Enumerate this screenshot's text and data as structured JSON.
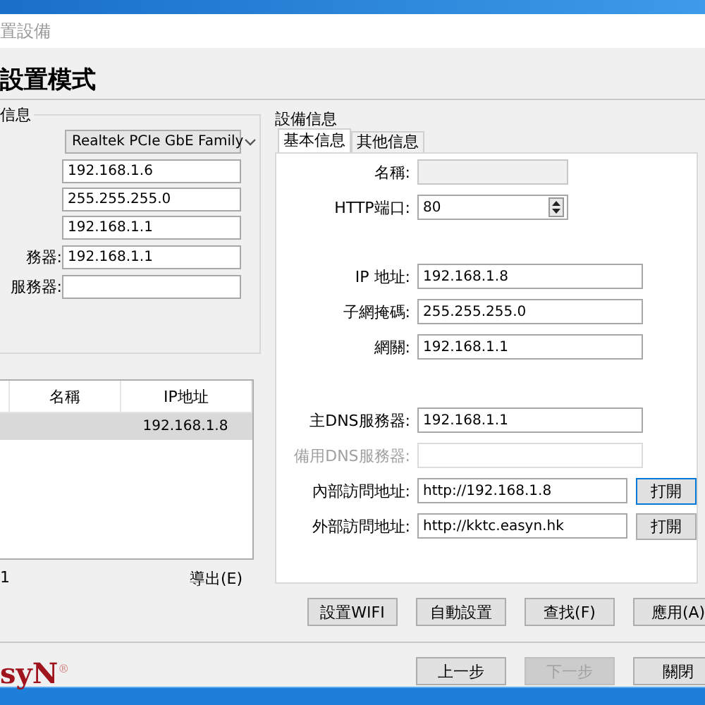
{
  "window": {
    "title": "置設備"
  },
  "heading": "設置模式",
  "network_group": {
    "title": "信息",
    "adapter": "Realtek PCIe GbE Family",
    "fields": [
      {
        "value": "192.168.1.6"
      },
      {
        "value": "255.255.255.0"
      },
      {
        "value": "192.168.1.1"
      },
      {
        "label": "務器:",
        "value": "192.168.1.1"
      },
      {
        "label": "服務器:"
      }
    ]
  },
  "device_table": {
    "columns": [
      "名稱",
      "IP地址"
    ],
    "rows": [
      {
        "ip": "192.168.1.8",
        "selected": true
      }
    ]
  },
  "device_count": "1",
  "export_link": "導出(E)",
  "device_info": {
    "title": "設備信息",
    "tabs": [
      {
        "label": "基本信息",
        "selected": true
      },
      {
        "label": "其他信息",
        "selected": false
      }
    ],
    "sections": [
      [
        {
          "kind": "text",
          "label": "名稱:",
          "read_only": true
        },
        {
          "kind": "spinner",
          "label": "HTTP端口:",
          "value": "80"
        }
      ],
      [
        {
          "kind": "text",
          "label": "IP 地址:",
          "value": "192.168.1.8"
        },
        {
          "kind": "text",
          "label": "子網掩碼:",
          "value": "255.255.255.0"
        },
        {
          "kind": "text",
          "label": "網關:",
          "value": "192.168.1.1"
        }
      ],
      [
        {
          "kind": "text",
          "label": "主DNS服務器:",
          "value": "192.168.1.1"
        },
        {
          "kind": "text",
          "label": "備用DNS服務器:",
          "disabled": true
        },
        {
          "kind": "link",
          "label": "內部訪問地址:",
          "value": "http://192.168.1.8",
          "button": "打開",
          "focused": true
        },
        {
          "kind": "link",
          "label": "外部訪問地址:",
          "value": "http://kktc.easyn.hk",
          "button": "打開",
          "focused": false
        }
      ]
    ]
  },
  "action_buttons": [
    "設置WIFI",
    "自動設置",
    "查找(F)",
    "應用(A)"
  ],
  "logo": {
    "text": "syN",
    "mark": "®"
  },
  "nav_buttons": [
    {
      "label": "上一步",
      "disabled": false
    },
    {
      "label": "下一步",
      "disabled": true
    },
    {
      "label": "關閉",
      "disabled": false
    }
  ]
}
